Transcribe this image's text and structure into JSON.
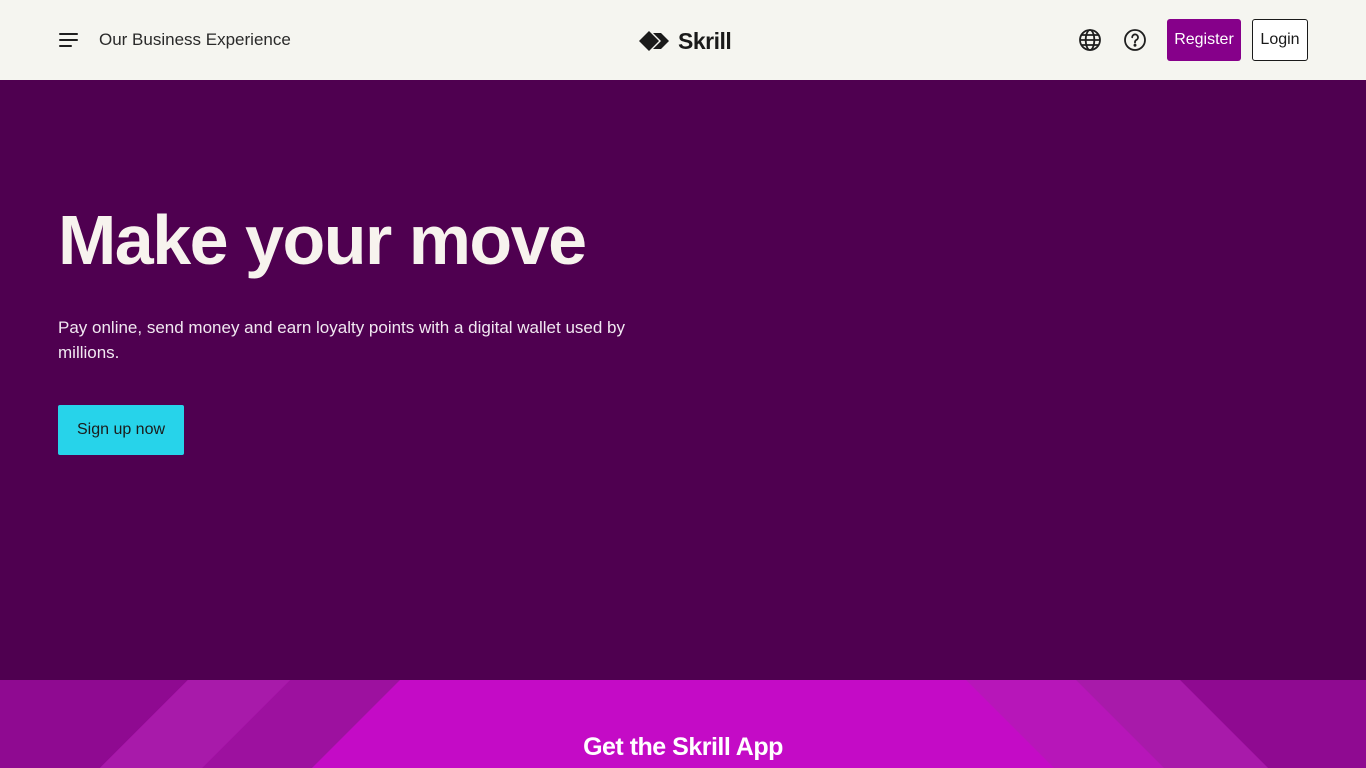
{
  "header": {
    "business_link": "Our Business Experience",
    "logo_text": "Skrill",
    "register_label": "Register",
    "login_label": "Login"
  },
  "hero": {
    "title": "Make your move",
    "subtitle": "Pay online, send money and earn loyalty points with a digital wallet used by millions.",
    "cta_label": "Sign up now"
  },
  "app_band": {
    "title": "Get the Skrill App"
  },
  "icons": {
    "menu": "hamburger-menu-icon",
    "logo": "skrill-diamond-logo-icon",
    "language": "globe-icon",
    "help": "question-circle-icon"
  },
  "colors": {
    "header_bg": "#f5f5f0",
    "hero_bg": "#4f0050",
    "register_bg": "#86008a",
    "cta_bg": "#27d3ea",
    "app_band_bg": "#c40bc6"
  }
}
